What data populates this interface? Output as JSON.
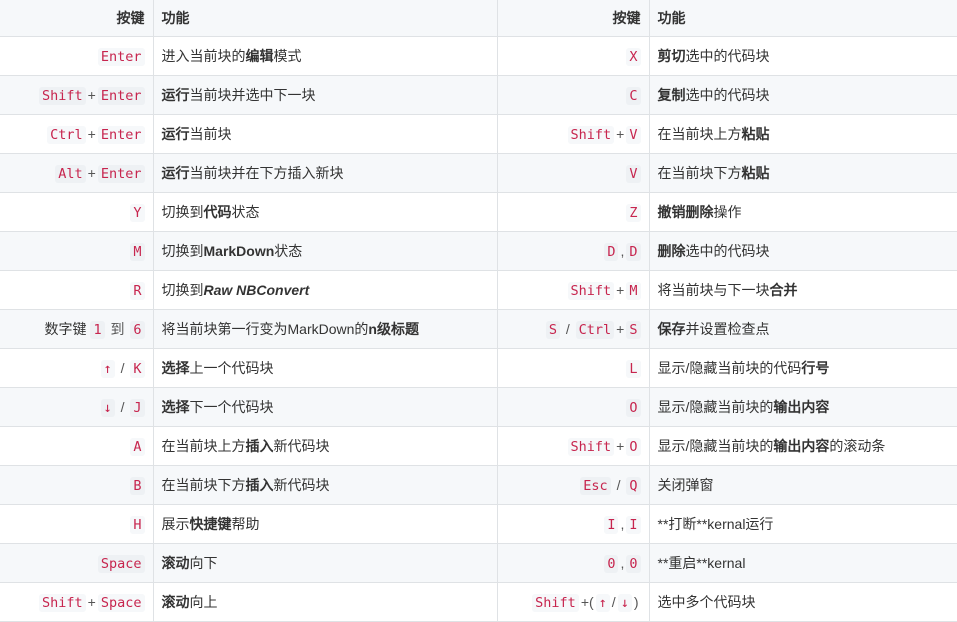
{
  "header": {
    "key_col": "按键",
    "func_col": "功能"
  },
  "rows": [
    {
      "lk": [
        {
          "c": "Enter"
        }
      ],
      "lf": [
        {
          "t": "进入当前块的"
        },
        {
          "b": "编辑"
        },
        {
          "t": "模式"
        }
      ],
      "rk": [
        {
          "c": "X"
        }
      ],
      "rf": [
        {
          "b": "剪切"
        },
        {
          "t": "选中的代码块"
        }
      ]
    },
    {
      "lk": [
        {
          "c": "Shift"
        },
        {
          "s": "+"
        },
        {
          "c": "Enter"
        }
      ],
      "lf": [
        {
          "b": "运行"
        },
        {
          "t": "当前块并选中下一块"
        }
      ],
      "rk": [
        {
          "c": "C"
        }
      ],
      "rf": [
        {
          "b": "复制"
        },
        {
          "t": "选中的代码块"
        }
      ]
    },
    {
      "lk": [
        {
          "c": "Ctrl"
        },
        {
          "s": "+"
        },
        {
          "c": "Enter"
        }
      ],
      "lf": [
        {
          "b": "运行"
        },
        {
          "t": "当前块"
        }
      ],
      "rk": [
        {
          "c": "Shift"
        },
        {
          "s": "+"
        },
        {
          "c": "V"
        }
      ],
      "rf": [
        {
          "t": "在当前块上方"
        },
        {
          "b": "粘贴"
        }
      ]
    },
    {
      "lk": [
        {
          "c": "Alt"
        },
        {
          "s": "+"
        },
        {
          "c": "Enter"
        }
      ],
      "lf": [
        {
          "b": "运行"
        },
        {
          "t": "当前块并在下方插入新块"
        }
      ],
      "rk": [
        {
          "c": "V"
        }
      ],
      "rf": [
        {
          "t": "在当前块下方"
        },
        {
          "b": "粘贴"
        }
      ]
    },
    {
      "lk": [
        {
          "c": "Y"
        }
      ],
      "lf": [
        {
          "t": "切换到"
        },
        {
          "b": "代码"
        },
        {
          "t": "状态"
        }
      ],
      "rk": [
        {
          "c": "Z"
        }
      ],
      "rf": [
        {
          "b": "撤销删除"
        },
        {
          "t": "操作"
        }
      ]
    },
    {
      "lk": [
        {
          "c": "M"
        }
      ],
      "lf": [
        {
          "t": "切换到"
        },
        {
          "b": "MarkDown"
        },
        {
          "t": "状态"
        }
      ],
      "rk": [
        {
          "c": "D"
        },
        {
          "s": ","
        },
        {
          "c": "D"
        }
      ],
      "rf": [
        {
          "b": "删除"
        },
        {
          "t": "选中的代码块"
        }
      ]
    },
    {
      "lk": [
        {
          "c": "R"
        }
      ],
      "lf": [
        {
          "t": "切换到"
        },
        {
          "bi": "Raw NBConvert"
        }
      ],
      "rk": [
        {
          "c": "Shift"
        },
        {
          "s": "+"
        },
        {
          "c": "M"
        }
      ],
      "rf": [
        {
          "t": "将当前块与下一块"
        },
        {
          "b": "合并"
        }
      ]
    },
    {
      "lk": [
        {
          "t": "数字键 "
        },
        {
          "c": "1"
        },
        {
          "s": " 到 "
        },
        {
          "c": "6"
        }
      ],
      "lf": [
        {
          "t": "将当前块第一行变为MarkDown的"
        },
        {
          "b": "n级标题"
        }
      ],
      "rk": [
        {
          "c": "S"
        },
        {
          "s": " / "
        },
        {
          "c": "Ctrl"
        },
        {
          "s": "+"
        },
        {
          "c": "S"
        }
      ],
      "rf": [
        {
          "b": "保存"
        },
        {
          "t": "并设置检查点"
        }
      ]
    },
    {
      "lk": [
        {
          "c": "↑"
        },
        {
          "s": " / "
        },
        {
          "c": "K"
        }
      ],
      "lf": [
        {
          "b": "选择"
        },
        {
          "t": "上一个代码块"
        }
      ],
      "rk": [
        {
          "c": "L"
        }
      ],
      "rf": [
        {
          "t": "显示/隐藏当前块的代码"
        },
        {
          "b": "行号"
        }
      ]
    },
    {
      "lk": [
        {
          "c": "↓"
        },
        {
          "s": " / "
        },
        {
          "c": "J"
        }
      ],
      "lf": [
        {
          "b": "选择"
        },
        {
          "t": "下一个代码块"
        }
      ],
      "rk": [
        {
          "c": "O"
        }
      ],
      "rf": [
        {
          "t": "显示/隐藏当前块的"
        },
        {
          "b": "输出内容"
        }
      ]
    },
    {
      "lk": [
        {
          "c": "A"
        }
      ],
      "lf": [
        {
          "t": "在当前块上方"
        },
        {
          "b": "插入"
        },
        {
          "t": "新代码块"
        }
      ],
      "rk": [
        {
          "c": "Shift"
        },
        {
          "s": "+"
        },
        {
          "c": "O"
        }
      ],
      "rf": [
        {
          "t": "显示/隐藏当前块的"
        },
        {
          "b": "输出内容"
        },
        {
          "t": "的滚动条"
        }
      ]
    },
    {
      "lk": [
        {
          "c": "B"
        }
      ],
      "lf": [
        {
          "t": "在当前块下方"
        },
        {
          "b": "插入"
        },
        {
          "t": "新代码块"
        }
      ],
      "rk": [
        {
          "c": "Esc"
        },
        {
          "s": " / "
        },
        {
          "c": "Q"
        }
      ],
      "rf": [
        {
          "t": "关闭弹窗"
        }
      ]
    },
    {
      "lk": [
        {
          "c": "H"
        }
      ],
      "lf": [
        {
          "t": "展示"
        },
        {
          "b": "快捷键"
        },
        {
          "t": "帮助"
        }
      ],
      "rk": [
        {
          "c": "I"
        },
        {
          "s": ","
        },
        {
          "c": "I"
        }
      ],
      "rf": [
        {
          "t": "**打断**kernal运行"
        }
      ]
    },
    {
      "lk": [
        {
          "c": "Space"
        }
      ],
      "lf": [
        {
          "b": "滚动"
        },
        {
          "t": "向下"
        }
      ],
      "rk": [
        {
          "c": "0"
        },
        {
          "s": ","
        },
        {
          "c": "0"
        }
      ],
      "rf": [
        {
          "t": "**重启**kernal"
        }
      ]
    },
    {
      "lk": [
        {
          "c": "Shift"
        },
        {
          "s": "+"
        },
        {
          "c": "Space"
        }
      ],
      "lf": [
        {
          "b": "滚动"
        },
        {
          "t": "向上"
        }
      ],
      "rk": [
        {
          "c": "Shift"
        },
        {
          "s": "+("
        },
        {
          "c": "↑"
        },
        {
          "s": "/"
        },
        {
          "c": "↓"
        },
        {
          "s": ")"
        }
      ],
      "rf": [
        {
          "t": "选中多个代码块"
        }
      ]
    }
  ]
}
